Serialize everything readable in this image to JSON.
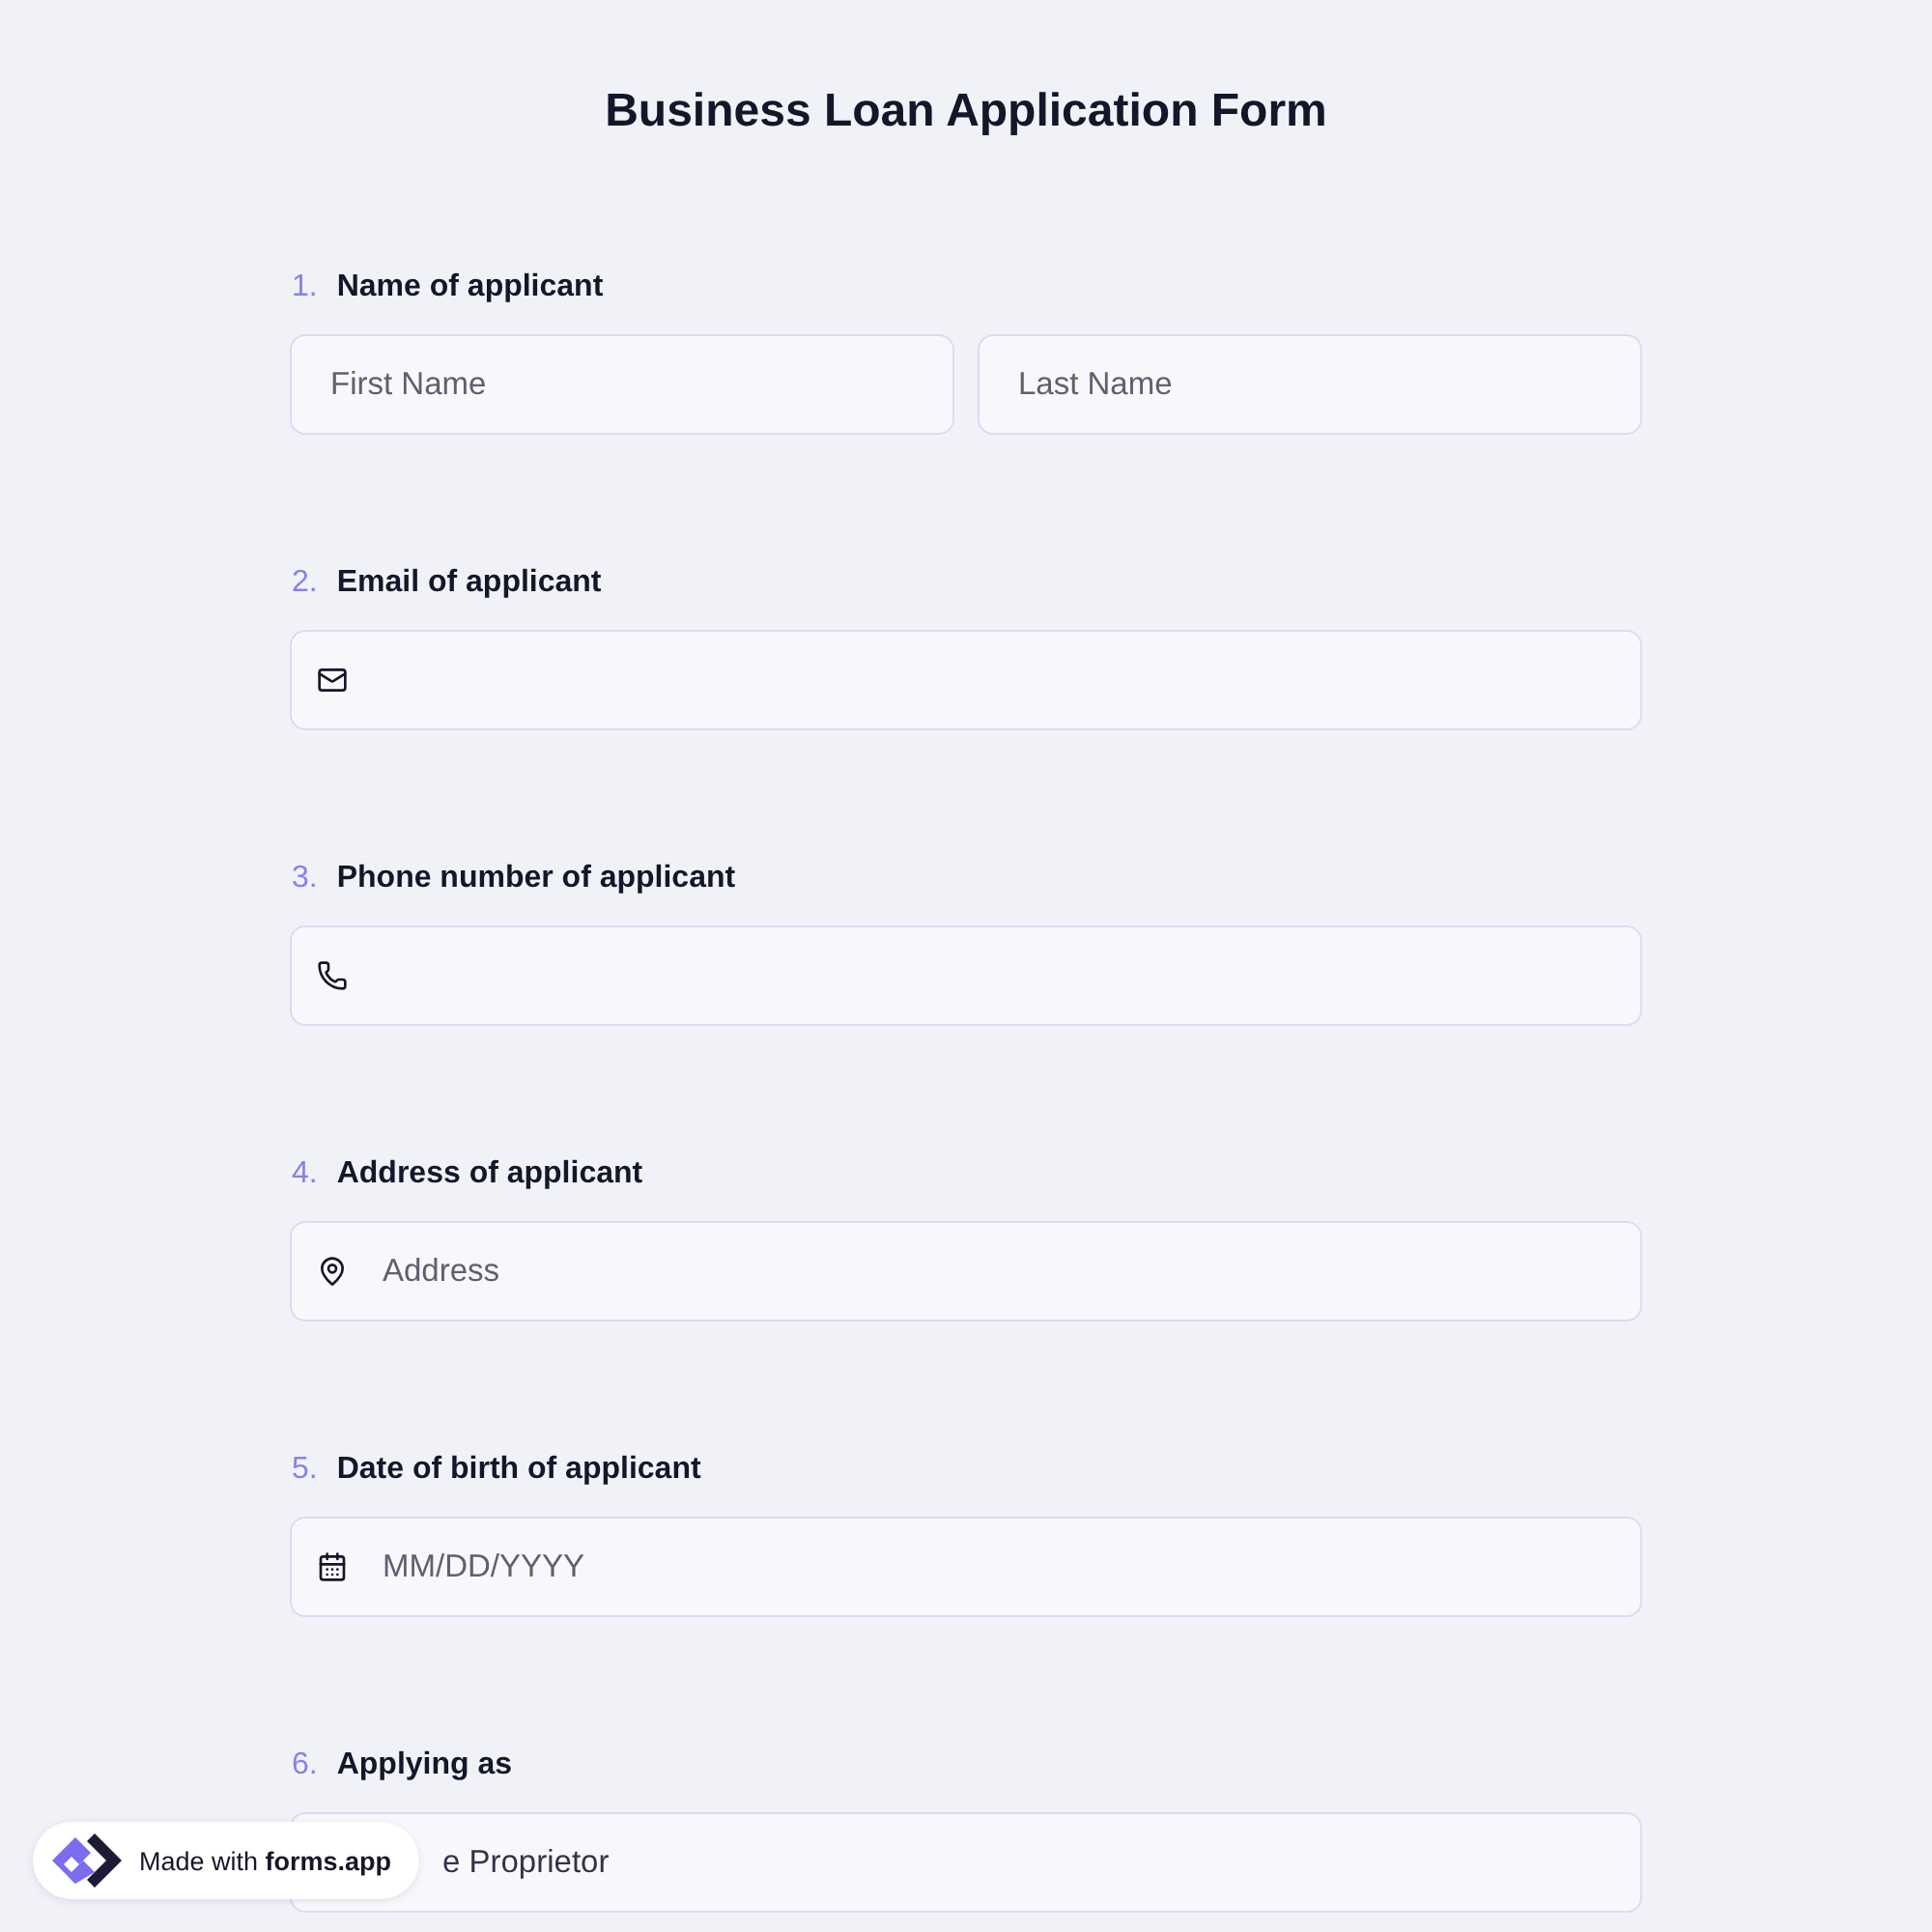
{
  "title": "Business Loan Application Form",
  "questions": [
    {
      "number": "1.",
      "label": "Name of applicant",
      "fields": [
        {
          "kind": "text",
          "placeholder": "First Name"
        },
        {
          "kind": "text",
          "placeholder": "Last Name"
        }
      ]
    },
    {
      "number": "2.",
      "label": "Email of applicant",
      "fields": [
        {
          "kind": "email"
        }
      ]
    },
    {
      "number": "3.",
      "label": "Phone number of applicant",
      "fields": [
        {
          "kind": "phone"
        }
      ]
    },
    {
      "number": "4.",
      "label": "Address of applicant",
      "fields": [
        {
          "kind": "address",
          "placeholder": "Address"
        }
      ]
    },
    {
      "number": "5.",
      "label": "Date of birth of applicant",
      "fields": [
        {
          "kind": "date",
          "placeholder": "MM/DD/YYYY"
        }
      ]
    },
    {
      "number": "6.",
      "label": "Applying as",
      "fields": [
        {
          "kind": "select",
          "value": "e Proprietor"
        }
      ]
    }
  ],
  "badge": {
    "text": "Made with **forms.app**"
  }
}
